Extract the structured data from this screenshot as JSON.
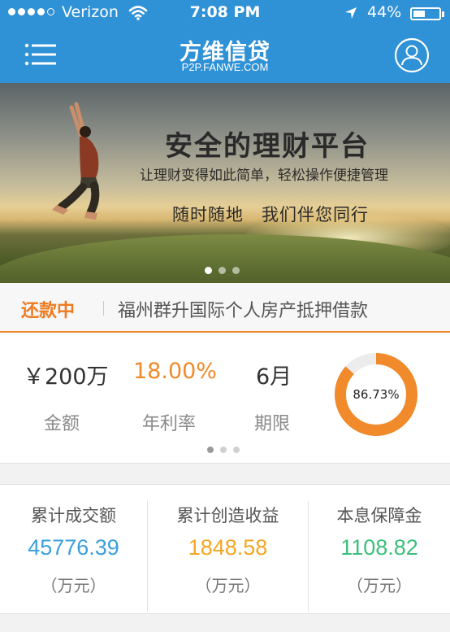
{
  "status_bar": {
    "carrier": "Verizon",
    "time": "7:08 PM",
    "battery": "44%",
    "battery_level": 0.44
  },
  "header": {
    "title": "方维信贷",
    "subtitle": "P2P.FANWE.COM",
    "menu_icon": "hamburger-menu-icon",
    "user_icon": "user-avatar-icon",
    "color": "#2f91d6"
  },
  "banner": {
    "headline": "安全的理财平台",
    "tagline": "让理财变得如此简单，轻松操作便捷管理",
    "slogan": "随时随地　我们伴您同行",
    "active_slide": 1,
    "slide_count": 3
  },
  "notice": {
    "tag": "还款中",
    "text": "福州群升国际个人房产抵押借款"
  },
  "product": {
    "amount": "￥200万",
    "amount_label": "金额",
    "rate": "18.00%",
    "rate_label": "年利率",
    "term": "6月",
    "term_label": "期限",
    "progress_text": "86.73%",
    "progress": 0.8673,
    "active_page": 1,
    "page_count": 3,
    "accent": "#f08a2b"
  },
  "summary": [
    {
      "label": "累计成交额",
      "value": "45776.39",
      "unit": "（万元）",
      "color": "#3aa0dd"
    },
    {
      "label": "累计创造收益",
      "value": "1848.58",
      "unit": "（万元）",
      "color": "#f5a623"
    },
    {
      "label": "本息保障金",
      "value": "1108.82",
      "unit": "（万元）",
      "color": "#3cbf7a"
    }
  ]
}
